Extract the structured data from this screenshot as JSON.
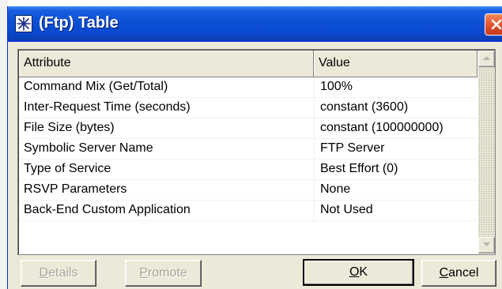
{
  "window": {
    "title": "(Ftp) Table",
    "icon": "star-icon",
    "close_icon": "close-x-icon"
  },
  "table": {
    "columns": [
      "Attribute",
      "Value"
    ],
    "rows": [
      {
        "attribute": "Command Mix (Get/Total)",
        "value": "100%"
      },
      {
        "attribute": "Inter-Request Time (seconds)",
        "value": "constant (3600)"
      },
      {
        "attribute": "File Size (bytes)",
        "value": "constant (100000000)"
      },
      {
        "attribute": "Symbolic Server Name",
        "value": "FTP Server"
      },
      {
        "attribute": "Type of Service",
        "value": "Best Effort (0)"
      },
      {
        "attribute": "RSVP Parameters",
        "value": "None"
      },
      {
        "attribute": "Back-End Custom Application",
        "value": "Not Used"
      }
    ]
  },
  "buttons": {
    "details": {
      "label": "Details",
      "mnemonic": "D",
      "rest": "etails",
      "enabled": false
    },
    "promote": {
      "label": "Promote",
      "mnemonic": "P",
      "rest": "romote",
      "enabled": false
    },
    "ok": {
      "label": "OK",
      "mnemonic": "O",
      "rest": "K",
      "enabled": true
    },
    "cancel": {
      "label": "Cancel",
      "mnemonic": "C",
      "rest": "ancel",
      "enabled": true
    }
  },
  "colors": {
    "titlebar": "#0a4ad0",
    "dialog_face": "#ece9d8",
    "close_button": "#e2522d",
    "disabled_text": "#a7a497"
  }
}
